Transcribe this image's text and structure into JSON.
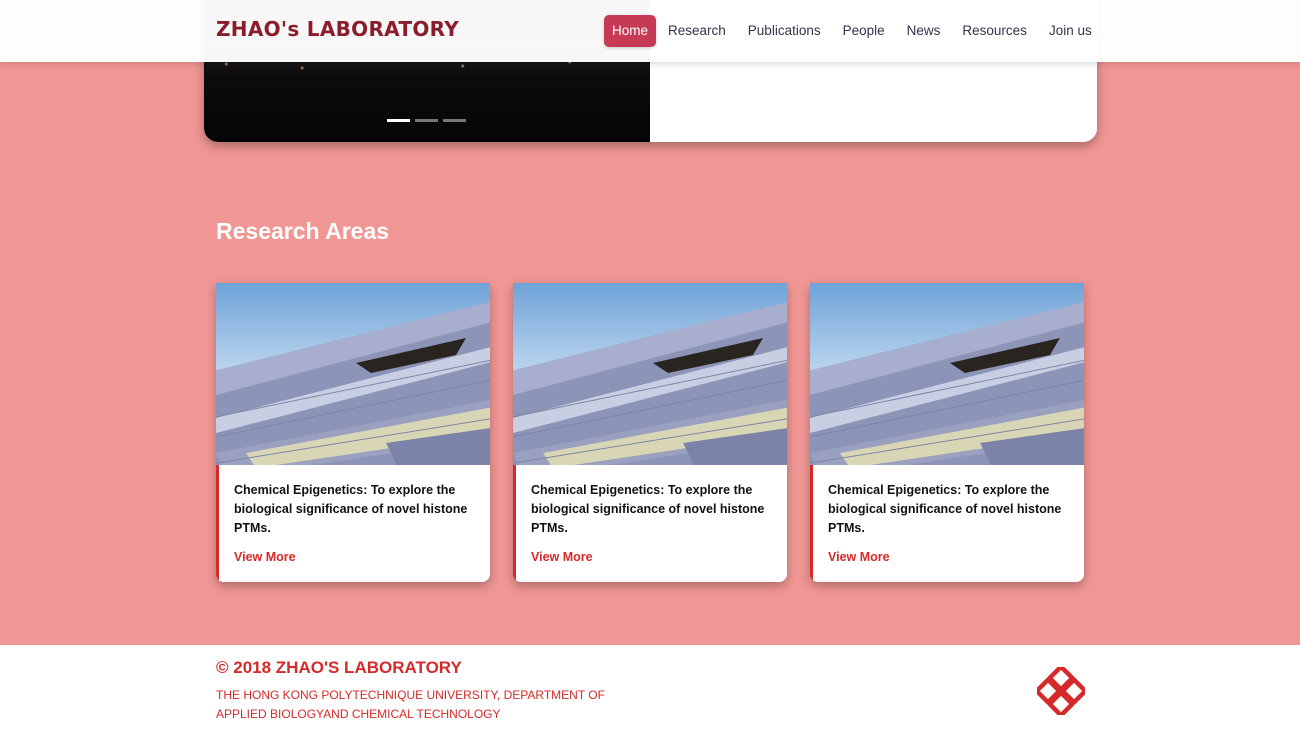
{
  "header": {
    "brand": "ZHAO's LABORATORY",
    "nav": [
      {
        "label": "Home",
        "active": true
      },
      {
        "label": "Research",
        "active": false
      },
      {
        "label": "Publications",
        "active": false
      },
      {
        "label": "People",
        "active": false
      },
      {
        "label": "News",
        "active": false
      },
      {
        "label": "Resources",
        "active": false
      },
      {
        "label": "Join us",
        "active": false
      }
    ]
  },
  "hero": {
    "slides": 3,
    "active_slide": 1
  },
  "research": {
    "title": "Research Areas",
    "cards": [
      {
        "text": "Chemical Epigenetics: To explore the biological significance of novel histone PTMs.",
        "link": "View More"
      },
      {
        "text": "Chemical Epigenetics: To explore the biological significance of novel histone PTMs.",
        "link": "View More"
      },
      {
        "text": "Chemical Epigenetics: To explore the biological significance of novel histone PTMs.",
        "link": "View More"
      }
    ]
  },
  "footer": {
    "copyright": "© 2018 ZHAO'S LABORATORY",
    "address": "THE HONG KONG POLYTECHNIQUE UNIVERSITY, DEPARTMENT OF APPLIED BIOLOGYAND CHEMICAL TECHNOLOGY"
  },
  "colors": {
    "background": "#f09694",
    "brand": "#8b1c2c",
    "nav_active": "#c63a55",
    "accent": "#d52a2a"
  }
}
